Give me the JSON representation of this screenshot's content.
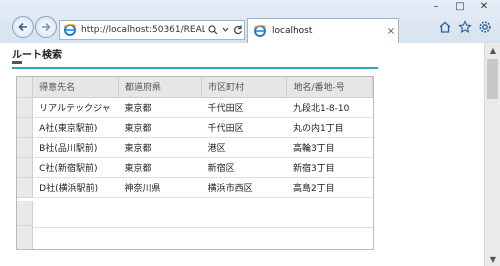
{
  "browser": {
    "url": "http://localhost:50361/REAL",
    "tab_title": "localhost",
    "tab_close": "×",
    "window_controls": [
      "–",
      "□",
      "✕"
    ]
  },
  "page": {
    "heading": "ルート検索",
    "table": {
      "headers": [
        "得意先名",
        "都道府県",
        "市区町村",
        "地名/番地-号"
      ],
      "rows": [
        [
          "リアルテックジャ",
          "東京都",
          "千代田区",
          "九段北1-8-10"
        ],
        [
          "A社(東京駅前)",
          "東京都",
          "千代田区",
          "丸の内1丁目"
        ],
        [
          "B社(品川駅前)",
          "東京都",
          "港区",
          "高輪3丁目"
        ],
        [
          "C社(新宿駅前)",
          "東京都",
          "新宿区",
          "新宿3丁目"
        ],
        [
          "D社(横浜駅前)",
          "神奈川県",
          "横浜市西区",
          "高島2丁目"
        ]
      ]
    }
  },
  "colors": {
    "accent": "#2aa7b6",
    "chrome": "#dbe6f2"
  }
}
